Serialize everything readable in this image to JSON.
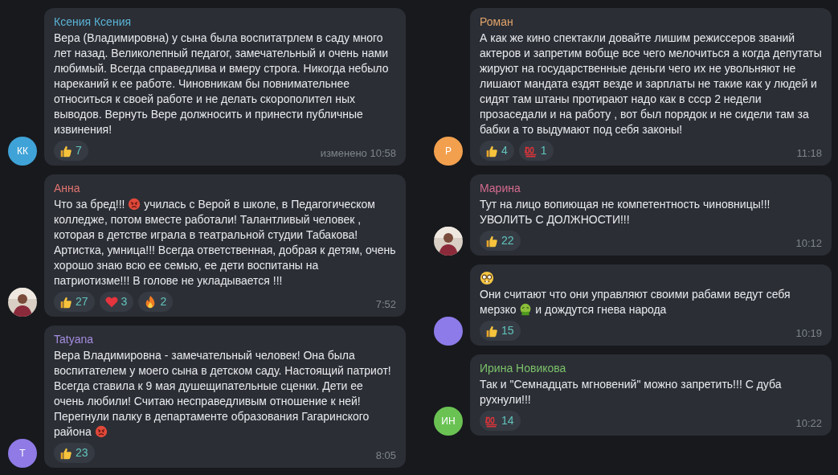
{
  "columns": [
    {
      "messages": [
        {
          "author": {
            "name": "Ксения Ксения",
            "color": "#5ab3d6"
          },
          "avatar": {
            "kind": "initials",
            "initials": "КК",
            "color": "#3fa3d8"
          },
          "body": [
            [
              {
                "kind": "text",
                "text": "Вера (Владимировна) у сына была воспитатрлем в саду много лет назад.  Великолепный педагог, замечательный и очень нами любимый. Всегда справедлива и вмеру строга. Никогда небыло нареканий к ее работе. Чиновникам бы повнимательнее относиться к своей работе и не делать скорополител ных выводов. Вернуть Вере должносить и принести публичные извинения!"
              }
            ]
          ],
          "reactions": [
            {
              "kind": "like",
              "count": "7"
            }
          ],
          "time": "изменено 10:58"
        },
        {
          "author": {
            "name": "Анна",
            "color": "#e0736f"
          },
          "avatar": {
            "kind": "picture"
          },
          "body": [
            [
              {
                "kind": "text",
                "text": "Что за бред!!! "
              },
              {
                "kind": "angry"
              },
              {
                "kind": "text",
                "text": " училась с Верой в школе, в Педагогическом колледже, потом вместе работали! Талантливый человек , которая в детстве  играла в  театральной студии Табакова! Артистка, умница!!! Всегда ответственная, добрая к детям, очень хорошо знаю всю ее семью, ее дети воспитаны на патриотизме!!! В голове не укладывается !!!"
              }
            ]
          ],
          "reactions": [
            {
              "kind": "like",
              "count": "27"
            },
            {
              "kind": "heart",
              "count": "3"
            },
            {
              "kind": "fire",
              "count": "2"
            }
          ],
          "time": "7:52"
        },
        {
          "author": {
            "name": "Tatyana",
            "color": "#a58de0"
          },
          "avatar": {
            "kind": "initials",
            "initials": "Т",
            "color": "#8f7ae6"
          },
          "body": [
            [
              {
                "kind": "text",
                "text": "Вера Владимировна - замечательный человек! Она была воспитателем у моего сына в детском саду. Настоящий патриот! Всегда ставила к 9 мая душещипательные сценки. Дети ее очень любили! Считаю несправедливым отношение к ней! Перегнули палку в департаменте образования Гагаринского района "
              },
              {
                "kind": "angry"
              }
            ]
          ],
          "reactions": [
            {
              "kind": "like",
              "count": "23"
            }
          ],
          "time": "8:05"
        }
      ]
    },
    {
      "messages": [
        {
          "author": {
            "name": "Роман",
            "color": "#e0a36a"
          },
          "avatar": {
            "kind": "initials",
            "initials": "Р",
            "color": "#f2a04e"
          },
          "body": [
            [
              {
                "kind": "text",
                "text": "А как же кино  спектакли довайте лишим  режиссеров званий актеров и запретим вобще все чего мелочиться а когда депутаты жируют на государственные деньги чего их не увольняют не лишают мандата ездят везде и зарплаты не такие как у людей и сидят там штаны протирают   надо как в ссср 2 недели прозаседали и на работу , вот был порядок и не сидели там за бабки а то выдумают под себя законы!"
              }
            ]
          ],
          "reactions": [
            {
              "kind": "like",
              "count": "4"
            },
            {
              "kind": "hundred",
              "count": "1"
            }
          ],
          "time": "11:18"
        },
        {
          "author": {
            "name": "Марина",
            "color": "#d46b8e"
          },
          "avatar": {
            "kind": "picture"
          },
          "body": [
            [
              {
                "kind": "text",
                "text": "Тут на лицо вопиющая не компетентность чиновницы!!! УВОЛИТЬ С ДОЛЖНОСТИ!!!"
              }
            ]
          ],
          "reactions": [
            {
              "kind": "like",
              "count": "22"
            }
          ],
          "time": "10:12"
        },
        {
          "avatar": {
            "kind": "plain",
            "color": "#8e7bea"
          },
          "body": [
            [
              {
                "kind": "nerd"
              }
            ],
            [
              {
                "kind": "text",
                "text": "Они считают что они управляют своими рабами ведут себя мерзко "
              },
              {
                "kind": "sick"
              },
              {
                "kind": "text",
                "text": " и дождутся гнева народа"
              }
            ]
          ],
          "reactions": [
            {
              "kind": "like",
              "count": "15"
            }
          ],
          "time": "10:19"
        },
        {
          "author": {
            "name": "Ирина Новикова",
            "color": "#7cc26a"
          },
          "avatar": {
            "kind": "initials",
            "initials": "ИН",
            "color": "#6ac253"
          },
          "body": [
            [
              {
                "kind": "text",
                "text": "Так и \"Семнадцать мгновений\" можно запретить!!! С дуба рухнули!!!"
              }
            ]
          ],
          "reactions": [
            {
              "kind": "hundred",
              "count": "14"
            }
          ],
          "time": "10:22"
        }
      ]
    }
  ]
}
